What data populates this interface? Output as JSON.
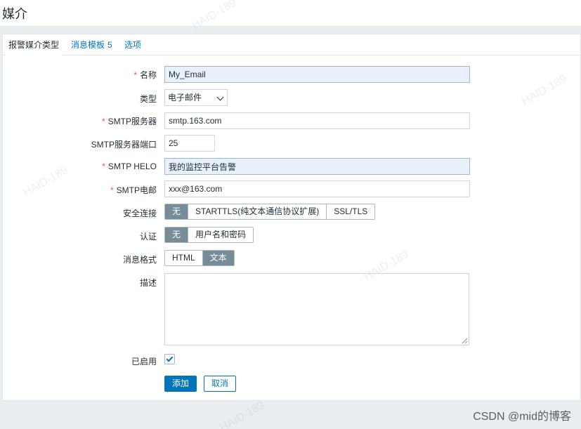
{
  "page": {
    "title": "媒介"
  },
  "tabs": [
    {
      "label": "报警媒介类型"
    },
    {
      "label": "消息模板",
      "count": "5"
    },
    {
      "label": "选项"
    }
  ],
  "form": {
    "name": {
      "label": "名称",
      "value": "My_Email"
    },
    "type": {
      "label": "类型",
      "value": "电子邮件"
    },
    "smtp_server": {
      "label": "SMTP服务器",
      "value": "smtp.163.com"
    },
    "smtp_port": {
      "label": "SMTP服务器端口",
      "value": "25"
    },
    "smtp_helo": {
      "label": "SMTP HELO",
      "value": "我的监控平台告警"
    },
    "smtp_email": {
      "label": "SMTP电邮",
      "placeholder": "xxx@163.com"
    },
    "security": {
      "label": "安全连接",
      "options": [
        "无",
        "STARTTLS(纯文本通信协议扩展)",
        "SSL/TLS"
      ],
      "selected": "无"
    },
    "auth": {
      "label": "认证",
      "options": [
        "无",
        "用户名和密码"
      ],
      "selected": "无"
    },
    "message_format": {
      "label": "消息格式",
      "options": [
        "HTML",
        "文本"
      ],
      "selected": "文本"
    },
    "description": {
      "label": "描述",
      "value": ""
    },
    "enabled": {
      "label": "已启用",
      "checked": true
    }
  },
  "buttons": {
    "add": "添加",
    "cancel": "取消"
  },
  "watermark": "HAID-189",
  "credit": "CSDN @mid的博客",
  "colors": {
    "accent": "#0275b8",
    "segment_on": "#768d99",
    "required": "#e45959",
    "filled_input": "#e8f1fb"
  }
}
